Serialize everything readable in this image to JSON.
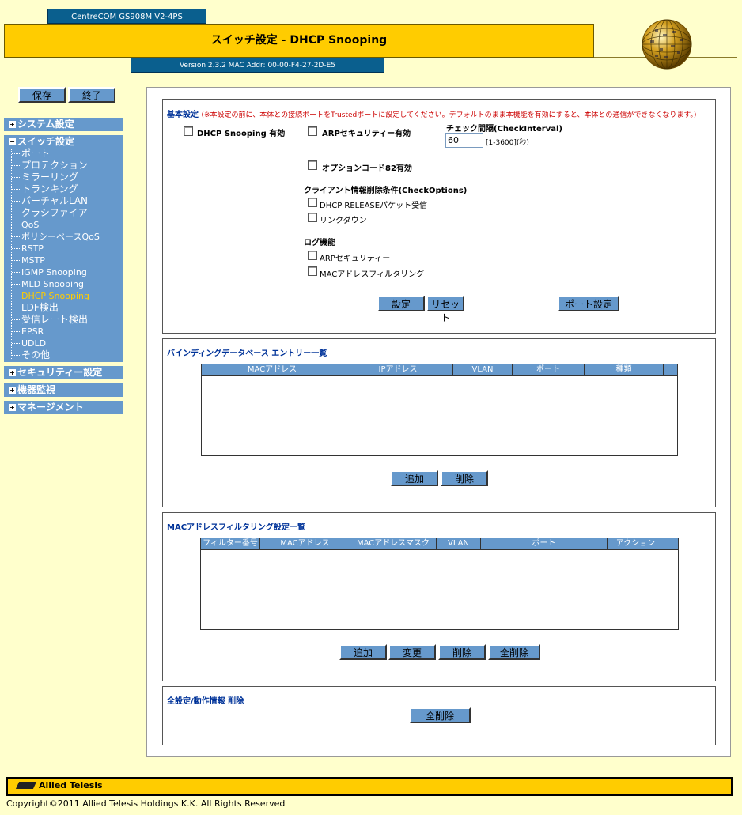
{
  "header": {
    "model": "CentreCOM GS908M V2-4PS",
    "title": "スイッチ設定 - DHCP Snooping",
    "version": "Version 2.3.2 MAC Addr: 00-00-F4-27-2D-E5"
  },
  "nav": {
    "save": "保存",
    "exit": "終了",
    "system": "システム設定",
    "switch": "スイッチ設定",
    "items": [
      "ポート",
      "プロテクション",
      "ミラーリング",
      "トランキング",
      "バーチャルLAN",
      "クラシファイア",
      "QoS",
      "ポリシーベースQoS",
      "RSTP",
      "MSTP",
      "IGMP Snooping",
      "MLD Snooping",
      "DHCP Snooping",
      "LDF検出",
      "受信レート検出",
      "EPSR",
      "UDLD",
      "その他"
    ],
    "security": "セキュリティー設定",
    "monitor": "機器監視",
    "management": "マネージメント",
    "plus": "+",
    "minus": "−"
  },
  "basic": {
    "title": "基本設定",
    "note": "(※本設定の前に、本体との接続ポートをTrustedポートに設定してください。デフォルトのまま本機能を有効にすると、本体との通信ができなくなります。)",
    "dhcp_enable": "DHCP Snooping 有効",
    "arp_enable": "ARPセキュリティー有効",
    "interval_label": "チェック間隔(CheckInterval)",
    "interval_value": "60",
    "interval_range": "[1-3600](秒)",
    "option82": "オプションコード82有効",
    "check_options": "クライアント情報削除条件(CheckOptions)",
    "release": "DHCP RELEASEパケット受信",
    "linkdown": "リンクダウン",
    "log": "ログ機能",
    "log_arp": "ARPセキュリティー",
    "log_mac": "MACアドレスフィルタリング",
    "set": "設定",
    "reset": "リセット",
    "port_setting": "ポート設定"
  },
  "binding": {
    "title": "バインディングデータベース エントリー一覧",
    "columns": [
      "MACアドレス",
      "IPアドレス",
      "VLAN",
      "ポート",
      "種類"
    ],
    "add": "追加",
    "delete": "削除"
  },
  "macfilter": {
    "title": "MACアドレスフィルタリング設定一覧",
    "columns": [
      "フィルター番号",
      "MACアドレス",
      "MACアドレスマスク",
      "VLAN",
      "ポート",
      "アクション"
    ],
    "add": "追加",
    "change": "変更",
    "delete": "削除",
    "delete_all": "全削除"
  },
  "clear": {
    "title": "全設定/動作情報 削除",
    "delete_all": "全削除"
  },
  "footer": {
    "brand": "Allied Telesis",
    "copyright": "Copyright©2011 Allied Telesis Holdings K.K. All Rights Reserved"
  },
  "colors": {
    "background": "#ffffcc",
    "accent": "#ffcc00",
    "nav": "#6699cc",
    "dark_bar": "#0a5f8e",
    "warning": "#cc0000",
    "heading": "#003399"
  }
}
